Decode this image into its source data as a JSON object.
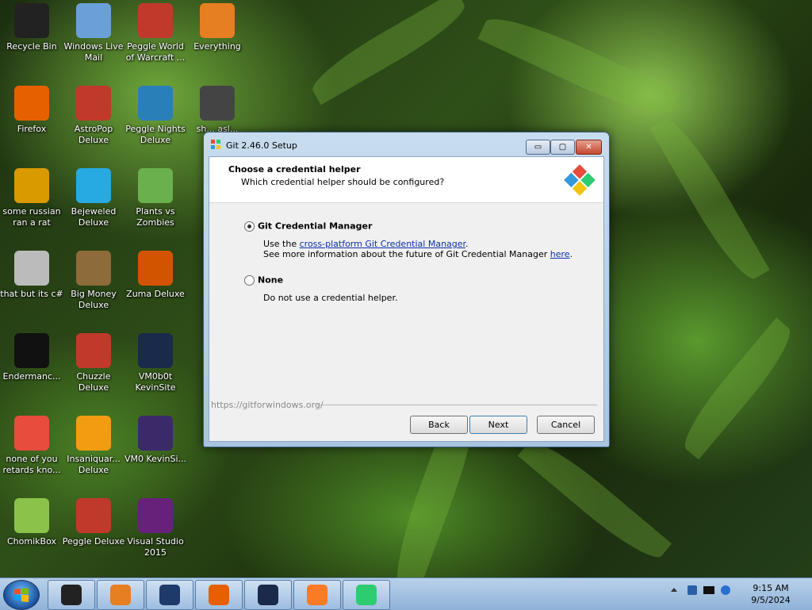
{
  "desktop_icons": [
    {
      "label": "Recycle Bin",
      "icon": "recycle-bin-icon",
      "color": "#222"
    },
    {
      "label": "Windows Live Mail",
      "icon": "mail-icon",
      "color": "#6aa0d8"
    },
    {
      "label": "Peggle World of Warcraft ...",
      "icon": "peggle-icon",
      "color": "#c0392b"
    },
    {
      "label": "Everything",
      "icon": "search-icon",
      "color": "#e67e22"
    },
    {
      "label": "Firefox",
      "icon": "firefox-icon",
      "color": "#e66000"
    },
    {
      "label": "AstroPop Deluxe",
      "icon": "astropop-icon",
      "color": "#c0392b"
    },
    {
      "label": "Peggle Nights Deluxe",
      "icon": "peggle-icon",
      "color": "#2980b9"
    },
    {
      "label": "sh... asl...",
      "icon": "file-icon",
      "color": "#444"
    },
    {
      "label": "some russian ran a rat",
      "icon": "de-icon",
      "color": "#d99a00"
    },
    {
      "label": "Bejeweled Deluxe",
      "icon": "gem-icon",
      "color": "#27aae1"
    },
    {
      "label": "Plants vs Zombies",
      "icon": "plant-icon",
      "color": "#6ab04c"
    },
    {
      "label": "that but its c#",
      "icon": "windows-stack-icon",
      "color": "#bbb"
    },
    {
      "label": "Big Money Deluxe",
      "icon": "money-bag-icon",
      "color": "#8e6b3a"
    },
    {
      "label": "Zuma Deluxe",
      "icon": "zuma-icon",
      "color": "#d35400"
    },
    {
      "label": "Endermanc...",
      "icon": "terminal-icon",
      "color": "#111"
    },
    {
      "label": "Chuzzle Deluxe",
      "icon": "chuzzle-icon",
      "color": "#c0392b"
    },
    {
      "label": "VM0b0t KevinSite",
      "icon": "vm-icon",
      "color": "#1a2a4a"
    },
    {
      "label": "none of you retards kno...",
      "icon": "dragon-icon",
      "color": "#e74c3c"
    },
    {
      "label": "Insaniquar... Deluxe",
      "icon": "fish-icon",
      "color": "#f39c12"
    },
    {
      "label": "VM0 KevinSi...",
      "icon": "firefox-file-icon",
      "color": "#3b2a6a"
    },
    {
      "label": "ChomikBox",
      "icon": "chomikbox-icon",
      "color": "#8bc34a"
    },
    {
      "label": "Peggle Deluxe",
      "icon": "peggle-icon",
      "color": "#c0392b"
    },
    {
      "label": "Visual Studio 2015",
      "icon": "visual-studio-icon",
      "color": "#68217a"
    }
  ],
  "dialog": {
    "title": "Git 2.46.0 Setup",
    "header_title": "Choose a credential helper",
    "header_subtitle": "Which credential helper should be configured?",
    "options": [
      {
        "label": "Git Credential Manager",
        "selected": true,
        "desc1_prefix": "Use the ",
        "desc1_link": "cross-platform Git Credential Manager",
        "desc1_suffix": ".",
        "desc2_prefix": "See more information about the future of Git Credential Manager ",
        "desc2_link": "here",
        "desc2_suffix": "."
      },
      {
        "label": "None",
        "selected": false,
        "desc": "Do not use a credential helper."
      }
    ],
    "brand": "https://gitforwindows.org/",
    "buttons": {
      "back": "Back",
      "next": "Next",
      "cancel": "Cancel"
    },
    "controls": {
      "minimize": "▭",
      "maximize": "▢",
      "close": "✕"
    }
  },
  "taskbar": {
    "apps": [
      "explorer",
      "media-player",
      "globe",
      "firefox",
      "vm",
      "xampp",
      "git-setup"
    ],
    "clock_time": "9:15 AM",
    "clock_date": "9/5/2024"
  }
}
